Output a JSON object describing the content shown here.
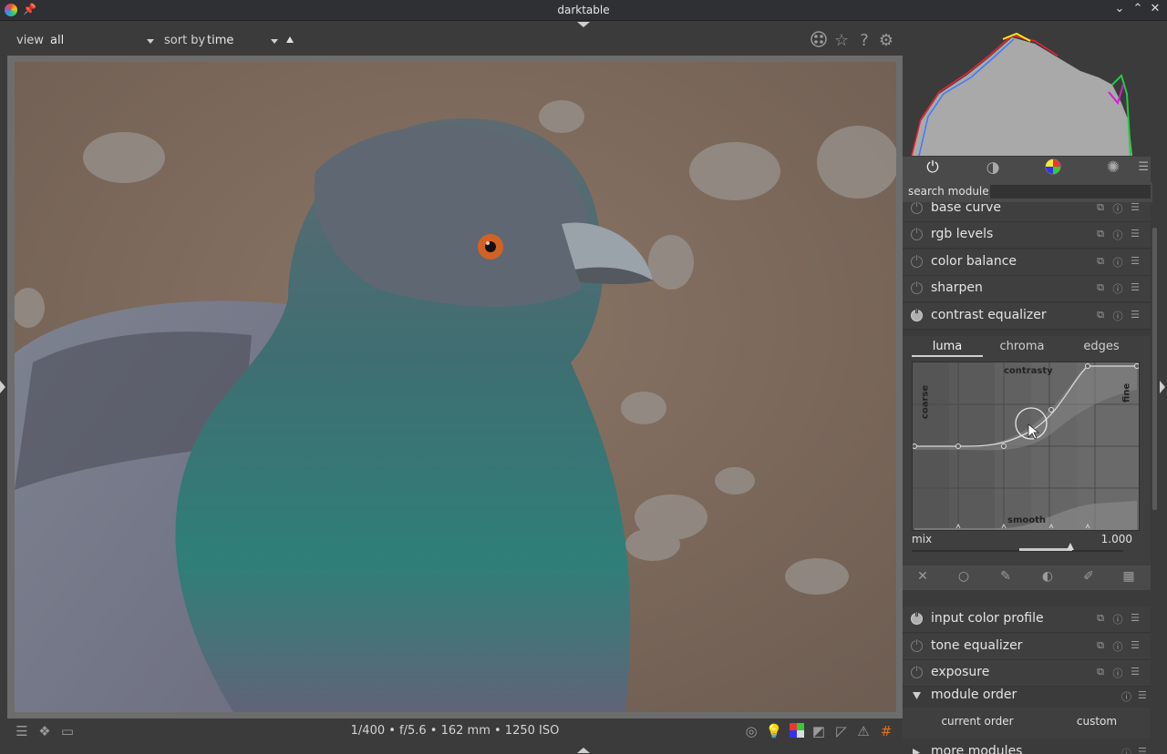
{
  "window": {
    "title": "darktable",
    "minimize": "⌄",
    "maximize": "⌃",
    "close": "✕"
  },
  "topbar": {
    "view_label": "view",
    "view_value": "all",
    "sort_label": "sort by",
    "sort_value": "time",
    "icons": [
      "grid-icon",
      "star-icon",
      "help-icon",
      "gear-icon"
    ]
  },
  "bottombar": {
    "exif_info": "1/400 • f/5.6 • 162 mm • 1250 ISO",
    "left_icons": [
      "filmstrip-icon",
      "styles-icon",
      "second-window-icon"
    ],
    "right_icons": [
      "focus-peaking-icon",
      "iso12646-icon",
      "softproof-icon",
      "gamut-check-icon",
      "raw-overexposed-icon",
      "clipping-icon",
      "guides-icon"
    ]
  },
  "right_panel": {
    "group_tabs": [
      "active-modules-icon",
      "base-group-icon",
      "color-group-icon",
      "effects-group-icon"
    ],
    "search_label": "search module",
    "search_value": "",
    "modules_top": [
      {
        "name": "base curve",
        "on": false
      },
      {
        "name": "rgb levels",
        "on": false
      },
      {
        "name": "color balance",
        "on": false
      },
      {
        "name": "sharpen",
        "on": false
      },
      {
        "name": "contrast equalizer",
        "on": true
      }
    ],
    "equalizer": {
      "tabs": [
        "luma",
        "chroma",
        "edges"
      ],
      "active_tab": "luma",
      "labels": {
        "top": "contrasty",
        "bottom": "smooth",
        "left": "coarse",
        "right": "fine"
      },
      "mix_label": "mix",
      "mix_value": "1.000",
      "mix_level": 1.0
    },
    "modules_bottom": [
      {
        "name": "input color profile",
        "on": true
      },
      {
        "name": "tone equalizer",
        "on": false
      },
      {
        "name": "exposure",
        "on": false
      }
    ],
    "module_order": {
      "title": "module order",
      "current": "current order",
      "custom": "custom"
    },
    "more_modules": "more modules"
  },
  "colors": {
    "panel": "#3b3b3b",
    "module": "#3f3f3f",
    "accent": "#d0d0d0"
  }
}
